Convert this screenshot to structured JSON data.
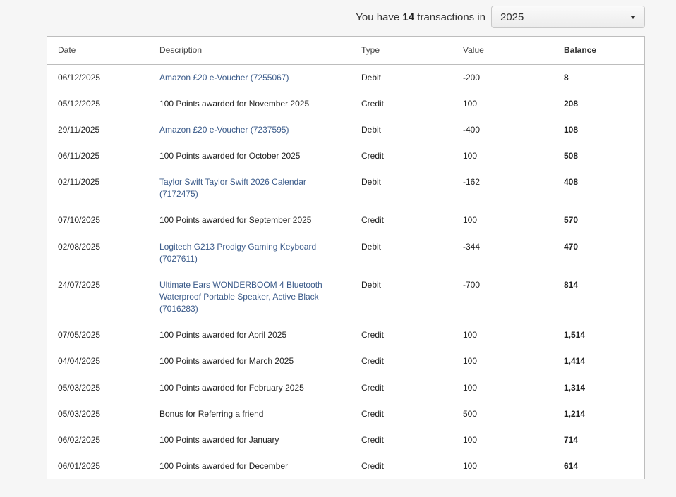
{
  "summary": {
    "prefix": "You have",
    "count": "14",
    "suffix": "transactions in"
  },
  "year_select": {
    "selected": "2025"
  },
  "table": {
    "headers": {
      "date": "Date",
      "description": "Description",
      "type": "Type",
      "value": "Value",
      "balance": "Balance"
    },
    "rows": [
      {
        "date": "06/12/2025",
        "description": "Amazon £20 e-Voucher (7255067)",
        "is_link": true,
        "type": "Debit",
        "value": "-200",
        "balance": "8"
      },
      {
        "date": "05/12/2025",
        "description": "100 Points awarded for November 2025",
        "is_link": false,
        "type": "Credit",
        "value": "100",
        "balance": "208"
      },
      {
        "date": "29/11/2025",
        "description": "Amazon £20 e-Voucher (7237595)",
        "is_link": true,
        "type": "Debit",
        "value": "-400",
        "balance": "108"
      },
      {
        "date": "06/11/2025",
        "description": "100 Points awarded for October 2025",
        "is_link": false,
        "type": "Credit",
        "value": "100",
        "balance": "508"
      },
      {
        "date": "02/11/2025",
        "description": "Taylor Swift Taylor Swift 2026 Calendar (7172475)",
        "is_link": true,
        "type": "Debit",
        "value": "-162",
        "balance": "408"
      },
      {
        "date": "07/10/2025",
        "description": "100 Points awarded for September 2025",
        "is_link": false,
        "type": "Credit",
        "value": "100",
        "balance": "570"
      },
      {
        "date": "02/08/2025",
        "description": "Logitech G213 Prodigy Gaming Keyboard (7027611)",
        "is_link": true,
        "type": "Debit",
        "value": "-344",
        "balance": "470"
      },
      {
        "date": "24/07/2025",
        "description": "Ultimate Ears WONDERBOOM 4 Bluetooth Waterproof Portable Speaker, Active Black (7016283)",
        "is_link": true,
        "type": "Debit",
        "value": "-700",
        "balance": "814"
      },
      {
        "date": "07/05/2025",
        "description": "100 Points awarded for April 2025",
        "is_link": false,
        "type": "Credit",
        "value": "100",
        "balance": "1,514"
      },
      {
        "date": "04/04/2025",
        "description": "100 Points awarded for March 2025",
        "is_link": false,
        "type": "Credit",
        "value": "100",
        "balance": "1,414"
      },
      {
        "date": "05/03/2025",
        "description": "100 Points awarded for February 2025",
        "is_link": false,
        "type": "Credit",
        "value": "100",
        "balance": "1,314"
      },
      {
        "date": "05/03/2025",
        "description": "Bonus for Referring a friend",
        "is_link": false,
        "type": "Credit",
        "value": "500",
        "balance": "1,214"
      },
      {
        "date": "06/02/2025",
        "description": "100 Points awarded for January",
        "is_link": false,
        "type": "Credit",
        "value": "100",
        "balance": "714"
      },
      {
        "date": "06/01/2025",
        "description": "100 Points awarded for December",
        "is_link": false,
        "type": "Credit",
        "value": "100",
        "balance": "614"
      }
    ]
  },
  "colors": {
    "link": "#3b5b8a",
    "border": "#bdbdbd"
  }
}
